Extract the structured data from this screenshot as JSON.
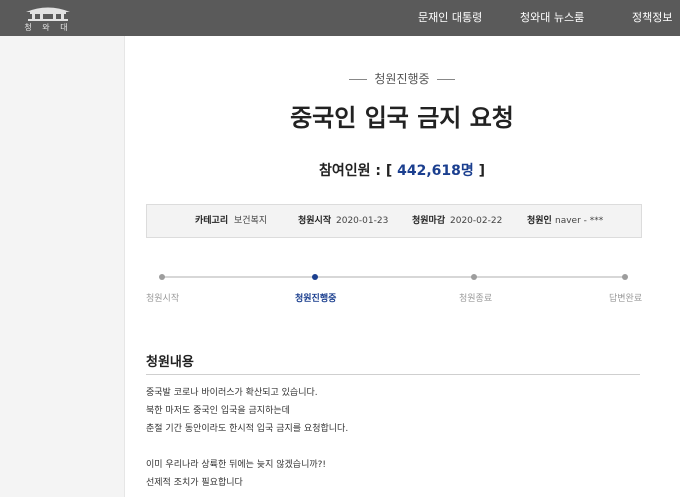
{
  "header": {
    "logo_text": "청 와 대",
    "nav": [
      "문재인 대통령",
      "청와대 뉴스룸",
      "정책정보"
    ]
  },
  "petition": {
    "status": "청원진행중",
    "title": "중국인 입국 금지 요청",
    "count_label": "참여인원 : [",
    "count_value": "442,618명",
    "count_close": "]",
    "info": {
      "category_label": "카테고리",
      "category_value": "보건복지",
      "start_label": "청원시작",
      "start_value": "2020-01-23",
      "end_label": "청원마감",
      "end_value": "2020-02-22",
      "author_label": "청원인",
      "author_value": "naver - ***"
    },
    "progress_steps": [
      "청원시작",
      "청원진행중",
      "청원종료",
      "답변완료"
    ],
    "progress_current_index": 1,
    "content_title": "청원내용",
    "content_lines": [
      "중국발 코로나 바이러스가 확산되고 있습니다.",
      "북한 마저도 중국인 입국을 금지하는데",
      "춘절 기간 동안이라도 한시적 입국 금지를 요청합니다.",
      "이미 우리나라 상륙한 뒤에는 늦지 않겠습니까?!",
      "선제적 조치가 필요합니다"
    ]
  },
  "colors": {
    "topbar": "#5a5a5a",
    "accent": "#1b3f8f"
  }
}
